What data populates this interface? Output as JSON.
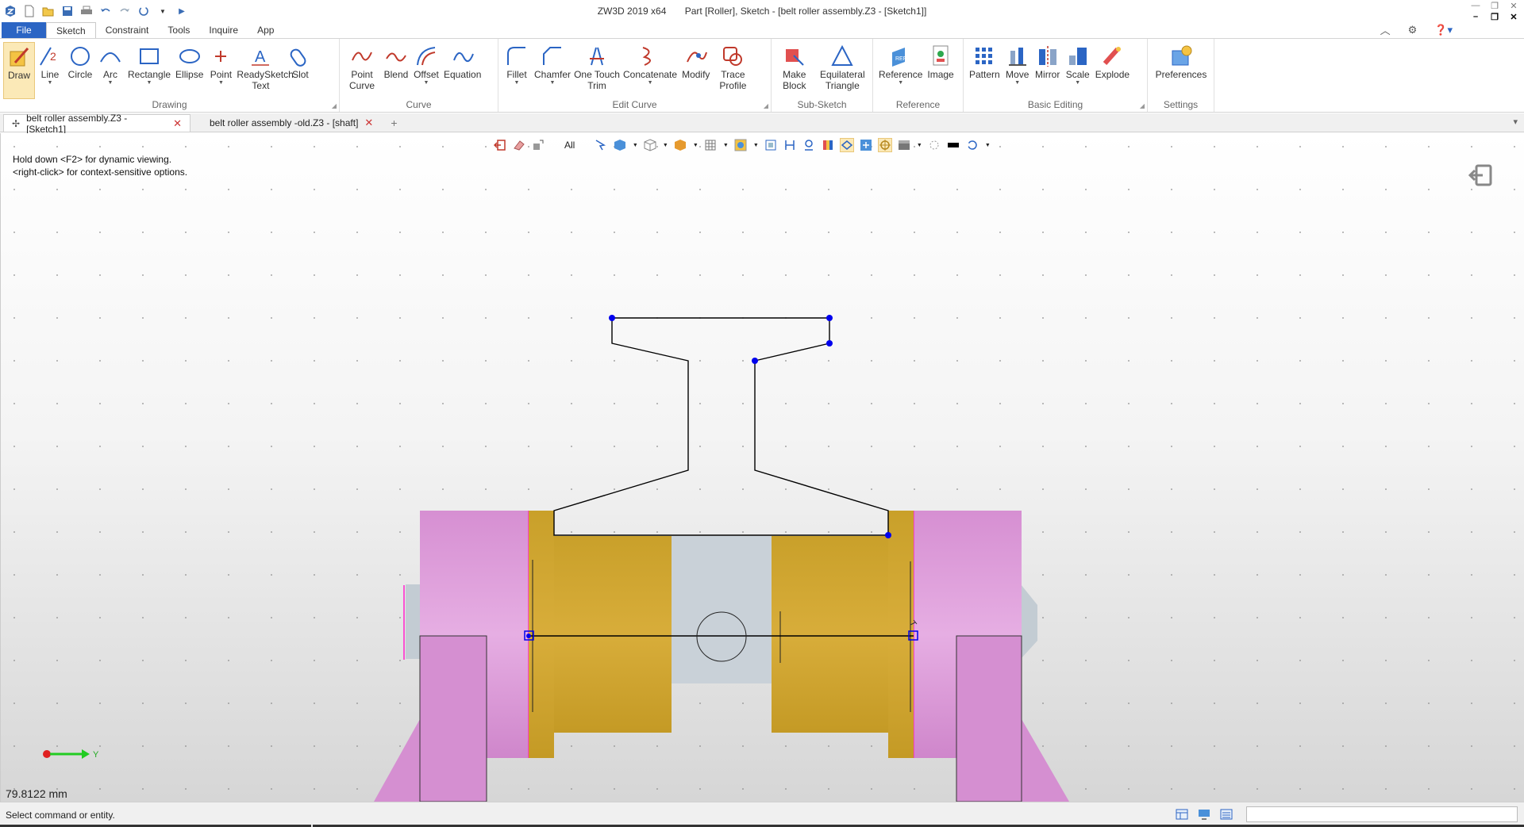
{
  "title": {
    "app": "ZW3D 2019  x64",
    "doc": "Part [Roller],  Sketch - [belt roller assembly.Z3 - [Sketch1]]"
  },
  "menu_tabs": [
    "File",
    "Sketch",
    "Constraint",
    "Tools",
    "Inquire",
    "App"
  ],
  "ribbon": {
    "groups": [
      {
        "label": "Drawing",
        "tools": [
          "Draw",
          "Line",
          "Circle",
          "Arc",
          "Rectangle",
          "Ellipse",
          "Point",
          "ReadySketch Text",
          "Slot"
        ]
      },
      {
        "label": "Curve",
        "tools": [
          "Point Curve",
          "Blend",
          "Offset",
          "Equation"
        ]
      },
      {
        "label": "Edit Curve",
        "tools": [
          "Fillet",
          "Chamfer",
          "One Touch Trim",
          "Concatenate",
          "Modify",
          "Trace Profile"
        ]
      },
      {
        "label": "Sub-Sketch",
        "tools": [
          "Make Block",
          "Equilateral Triangle"
        ]
      },
      {
        "label": "Reference",
        "tools": [
          "Reference",
          "Image"
        ]
      },
      {
        "label": "Basic Editing",
        "tools": [
          "Pattern",
          "Move",
          "Mirror",
          "Scale",
          "Explode"
        ]
      },
      {
        "label": "Settings",
        "tools": [
          "Preferences"
        ]
      }
    ]
  },
  "doc_tabs": [
    {
      "label": "belt roller assembly.Z3 - [Sketch1]",
      "active": true
    },
    {
      "label": "belt roller assembly -old.Z3 - [shaft]",
      "active": false
    }
  ],
  "viewport": {
    "filter": "All",
    "hint_line1": "Hold down <F2> for dynamic viewing.",
    "hint_line2": "<right-click> for context-sensitive options.",
    "measure": "79.8122 mm",
    "axis_label": "Y"
  },
  "status": {
    "text": "Select command or entity.",
    "input_value": ""
  },
  "colors": {
    "accent": "#2b65c4",
    "pink": "#d99cd6",
    "gold": "#c9a02a",
    "shaft": "#c8d0d6",
    "sketch_point": "#0000ee"
  }
}
